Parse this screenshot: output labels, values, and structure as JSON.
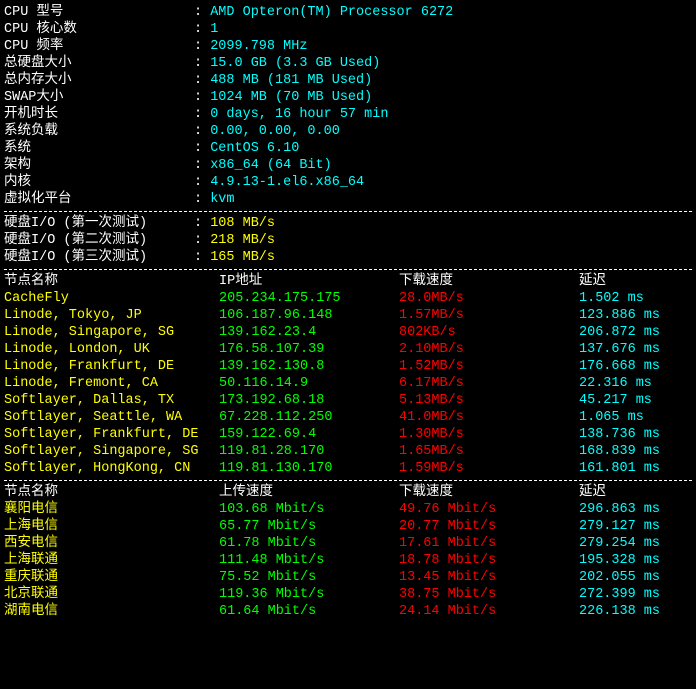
{
  "sysinfo": [
    {
      "label": "CPU 型号",
      "value": "AMD Opteron(TM) Processor 6272"
    },
    {
      "label": "CPU 核心数",
      "value": "1"
    },
    {
      "label": "CPU 频率",
      "value": "2099.798 MHz"
    },
    {
      "label": "总硬盘大小",
      "value": "15.0 GB (3.3 GB Used)"
    },
    {
      "label": "总内存大小",
      "value": "488 MB (181 MB Used)"
    },
    {
      "label": "SWAP大小",
      "value": "1024 MB (70 MB Used)"
    },
    {
      "label": "开机时长",
      "value": "0 days, 16 hour 57 min"
    },
    {
      "label": "系统负载",
      "value": "0.00, 0.00, 0.00"
    },
    {
      "label": "系统",
      "value": "CentOS 6.10"
    },
    {
      "label": "架构",
      "value": "x86_64 (64 Bit)"
    },
    {
      "label": "内核",
      "value": "4.9.13-1.el6.x86_64"
    },
    {
      "label": "虚拟化平台",
      "value": "kvm"
    }
  ],
  "diskio": [
    {
      "label": "硬盘I/O (第一次测试)",
      "value": "108 MB/s"
    },
    {
      "label": "硬盘I/O (第二次测试)",
      "value": "218 MB/s"
    },
    {
      "label": "硬盘I/O (第三次测试)",
      "value": "165 MB/s"
    }
  ],
  "net_header": {
    "c1": "节点名称",
    "c2": "IP地址",
    "c3": "下载速度",
    "c4": "延迟"
  },
  "net": [
    {
      "name": "CacheFly",
      "ip": "205.234.175.175",
      "speed": "28.0MB/s",
      "latency": "1.502 ms"
    },
    {
      "name": "Linode, Tokyo, JP",
      "ip": "106.187.96.148",
      "speed": "1.57MB/s",
      "latency": "123.886 ms"
    },
    {
      "name": "Linode, Singapore, SG",
      "ip": "139.162.23.4",
      "speed": "802KB/s",
      "latency": "206.872 ms"
    },
    {
      "name": "Linode, London, UK",
      "ip": "176.58.107.39",
      "speed": "2.10MB/s",
      "latency": "137.676 ms"
    },
    {
      "name": "Linode, Frankfurt, DE",
      "ip": "139.162.130.8",
      "speed": "1.52MB/s",
      "latency": "176.668 ms"
    },
    {
      "name": "Linode, Fremont, CA",
      "ip": "50.116.14.9",
      "speed": "6.17MB/s",
      "latency": "22.316 ms"
    },
    {
      "name": "Softlayer, Dallas, TX",
      "ip": "173.192.68.18",
      "speed": "5.13MB/s",
      "latency": "45.217 ms"
    },
    {
      "name": "Softlayer, Seattle, WA",
      "ip": "67.228.112.250",
      "speed": "41.0MB/s",
      "latency": "1.065 ms"
    },
    {
      "name": "Softlayer, Frankfurt, DE",
      "ip": "159.122.69.4",
      "speed": "1.30MB/s",
      "latency": "138.736 ms"
    },
    {
      "name": "Softlayer, Singapore, SG",
      "ip": "119.81.28.170",
      "speed": "1.65MB/s",
      "latency": "168.839 ms"
    },
    {
      "name": "Softlayer, HongKong, CN",
      "ip": "119.81.130.170",
      "speed": "1.59MB/s",
      "latency": "161.801 ms"
    }
  ],
  "cn_header": {
    "c1": "节点名称",
    "c2": "上传速度",
    "c3": "下载速度",
    "c4": "延迟"
  },
  "cn": [
    {
      "name": "襄阳电信",
      "up": "103.68 Mbit/s",
      "down": "49.76 Mbit/s",
      "latency": "296.863 ms"
    },
    {
      "name": "上海电信",
      "up": "65.77 Mbit/s",
      "down": "20.77 Mbit/s",
      "latency": "279.127 ms"
    },
    {
      "name": "西安电信",
      "up": "61.78 Mbit/s",
      "down": "17.61 Mbit/s",
      "latency": "279.254 ms"
    },
    {
      "name": "上海联通",
      "up": "111.48 Mbit/s",
      "down": "18.78 Mbit/s",
      "latency": "195.328 ms"
    },
    {
      "name": "重庆联通",
      "up": "75.52 Mbit/s",
      "down": "13.45 Mbit/s",
      "latency": "202.055 ms"
    },
    {
      "name": "北京联通",
      "up": "119.36 Mbit/s",
      "down": "38.75 Mbit/s",
      "latency": "272.399 ms"
    },
    {
      "name": "湖南电信",
      "up": "61.64 Mbit/s",
      "down": "24.14 Mbit/s",
      "latency": "226.138 ms"
    }
  ]
}
